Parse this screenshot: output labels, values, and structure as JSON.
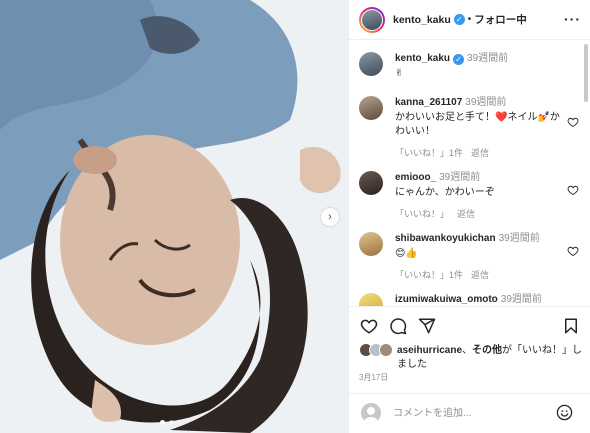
{
  "header": {
    "username": "kento_kaku",
    "separator": "•",
    "follow_status": "フォロー中",
    "more_icon": "more-icon"
  },
  "caption": {
    "username": "kento_kaku",
    "time": "39週間前",
    "text": "✌"
  },
  "comments": [
    {
      "username": "kanna_261107",
      "time": "39週間前",
      "text": "かわいいお足と手て！❤️ネイル💅かわいい！",
      "likes": "「いいね！」1件",
      "reply": "返信"
    },
    {
      "username": "emiooo_",
      "time": "39週間前",
      "text": "にゃんか、かわいーぞ",
      "likes": "「いいね！」",
      "reply": "返信"
    },
    {
      "username": "shibawankoyukichan",
      "time": "39週間前",
      "text": "😊👍",
      "likes": "「いいね！」1件",
      "reply": "返信"
    },
    {
      "username": "izumiwakuiwa_omoto",
      "time": "39週間前"
    }
  ],
  "likes_line": {
    "user": "aseihurricane",
    "mid": "、",
    "others": "その他",
    "suffix": "が「いいね！」しました"
  },
  "post_date": "3月17日",
  "comment_box": {
    "placeholder": "コメントを追加..."
  },
  "colors": {
    "verified": "#3897f0",
    "text": "#262626",
    "muted": "#8e8e8e",
    "heart": "#ed4956"
  }
}
